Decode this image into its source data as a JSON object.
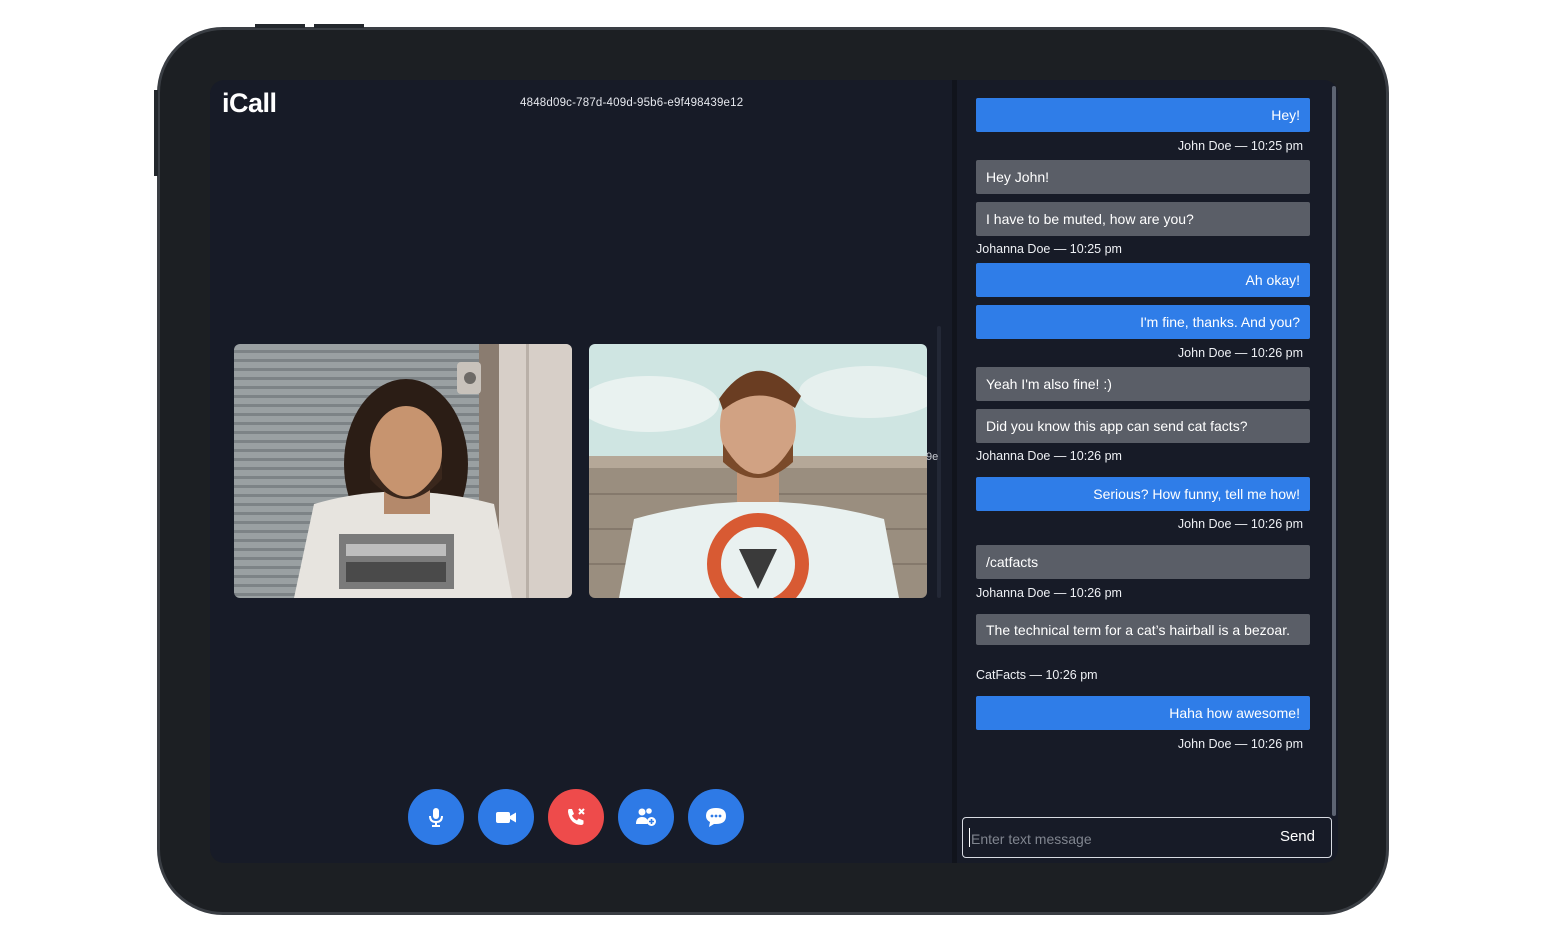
{
  "app": {
    "title": "iCall",
    "room_id": "4848d09c-787d-409d-95b6-e9f498439e12",
    "stray_text": "9e"
  },
  "controls": [
    {
      "name": "mic-button",
      "icon": "microphone-icon"
    },
    {
      "name": "camera-button",
      "icon": "video-camera-icon"
    },
    {
      "name": "hangup-button",
      "icon": "phone-hangup-icon"
    },
    {
      "name": "add-participant-button",
      "icon": "add-user-icon"
    },
    {
      "name": "chat-toggle-button",
      "icon": "chat-bubble-icon"
    }
  ],
  "chat": {
    "messages": [
      {
        "text": "Hey!",
        "sender": "me"
      },
      {
        "text": "Hey John!",
        "sender": "them"
      },
      {
        "text": "I have to be muted, how are you?",
        "sender": "them"
      },
      {
        "text": "Ah okay!",
        "sender": "me"
      },
      {
        "text": "I'm fine, thanks. And you?",
        "sender": "me"
      },
      {
        "text": "Yeah I'm also fine! :)",
        "sender": "them"
      },
      {
        "text": "Did you know this app can send cat facts?",
        "sender": "them"
      },
      {
        "text": "Serious? How funny, tell me how!",
        "sender": "me"
      },
      {
        "text": "/catfacts",
        "sender": "them"
      },
      {
        "text": "The technical term for a cat’s hairball is a bezoar.",
        "sender": "them"
      },
      {
        "text": "Haha how awesome!",
        "sender": "me"
      }
    ],
    "meta": [
      {
        "text": "John Doe  — 10:25 pm",
        "align": "right"
      },
      {
        "text": "Johanna Doe  — 10:25 pm",
        "align": "left"
      },
      {
        "text": "John Doe  — 10:26 pm",
        "align": "right"
      },
      {
        "text": "Johanna Doe  — 10:26 pm",
        "align": "left"
      },
      {
        "text": "John Doe  — 10:26 pm",
        "align": "right"
      },
      {
        "text": "Johanna Doe  — 10:26 pm",
        "align": "left"
      },
      {
        "text": "CatFacts  — 10:26 pm",
        "align": "left"
      },
      {
        "text": "John Doe  — 10:26 pm",
        "align": "right"
      }
    ],
    "input_placeholder": "Enter text message",
    "send_label": "Send"
  },
  "colors": {
    "accent": "#2f7de8",
    "hangup": "#ee4b4b",
    "bubble_other": "#5a5e67",
    "screen_bg": "#171b27"
  }
}
